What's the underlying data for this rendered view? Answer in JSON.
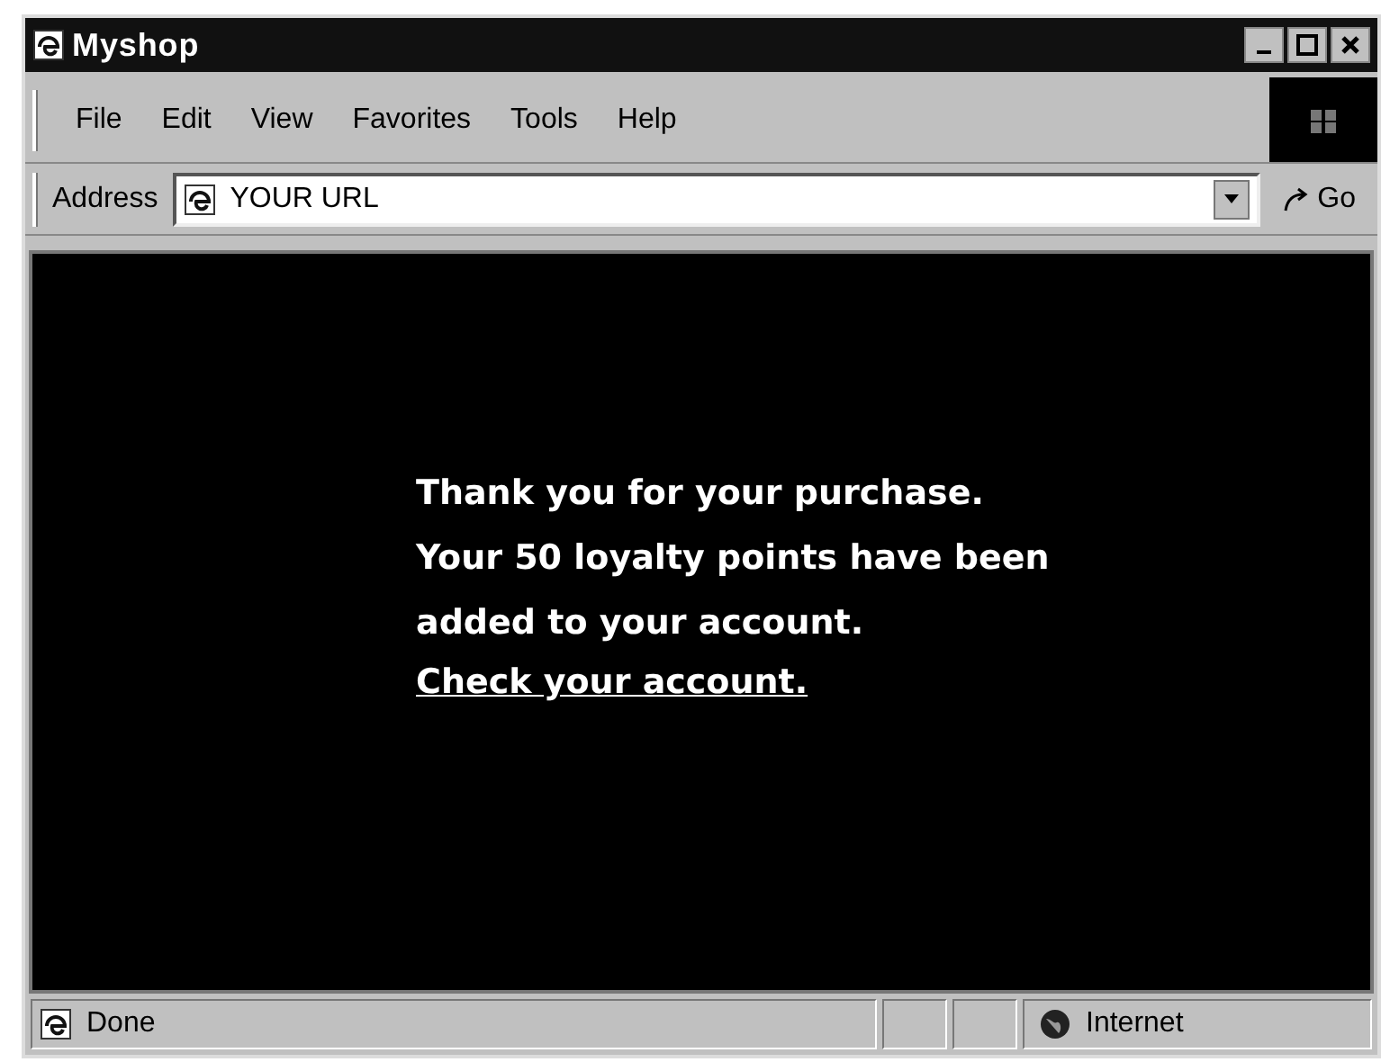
{
  "window": {
    "title": "Myshop"
  },
  "menu": [
    "File",
    "Edit",
    "View",
    "Favorites",
    "Tools",
    "Help"
  ],
  "address": {
    "label": "Address",
    "value": "YOUR URL",
    "go": "Go"
  },
  "message": {
    "lines": [
      "Thank you for your purchase.",
      "Your 50 loyalty points have been",
      "added to your account."
    ],
    "link": "Check your account."
  },
  "status_bar": {
    "status": "Done",
    "zone": "Internet"
  }
}
